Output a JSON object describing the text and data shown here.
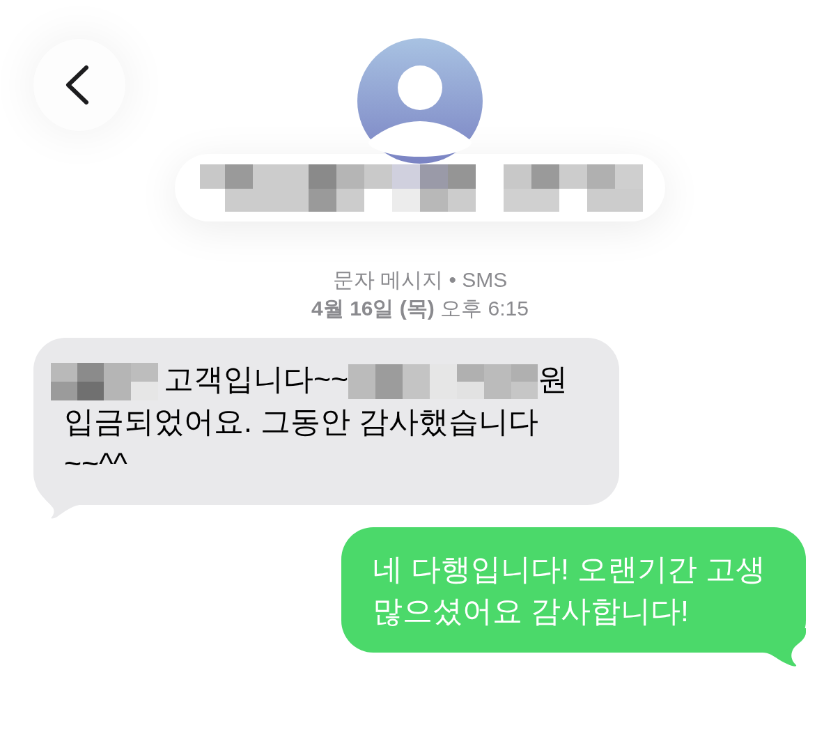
{
  "contact": {
    "name": [
      {
        "kind": "redacted"
      },
      {
        "kind": "redacted"
      }
    ]
  },
  "conversation": {
    "service": "문자 메시지 • SMS",
    "timestamp": "**4월 16일 (목)** 오후 6:15"
  },
  "messages": [
    {
      "kind": "incoming",
      "segments": [
        {
          "kind": "redacted"
        },
        {
          "kind": "text",
          "text": "고객입니다~~"
        },
        {
          "kind": "redacted"
        },
        {
          "kind": "text",
          "text": "원"
        },
        {
          "kind": "text",
          "text": "입금되었어요. 그동안 감사했습니다 ~~^^"
        }
      ]
    },
    {
      "kind": "outgoing",
      "segments": [
        {
          "kind": "text",
          "text": "네 다행입니다! 오랜기간 고생 많으셨어요 감사합니다!"
        }
      ]
    }
  ]
}
